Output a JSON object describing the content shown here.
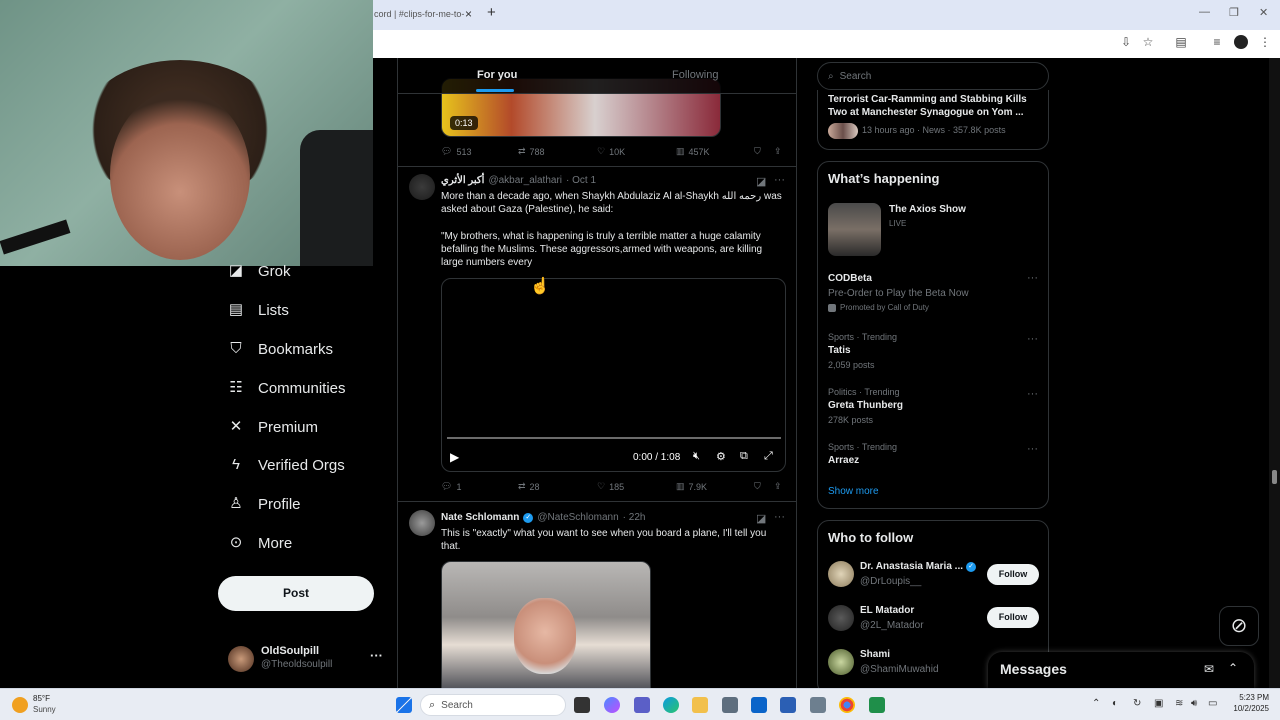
{
  "browser": {
    "tab_title": "cord | #clips-for-me-to-",
    "tab_close": "×",
    "new_tab": "+",
    "minimize": "—",
    "maximize": "❐",
    "close": "✕"
  },
  "nav": {
    "items": [
      {
        "label": "Grok",
        "icon": "grok-icon"
      },
      {
        "label": "Lists",
        "icon": "lists-icon"
      },
      {
        "label": "Bookmarks",
        "icon": "bookmark-icon"
      },
      {
        "label": "Communities",
        "icon": "communities-icon"
      },
      {
        "label": "Premium",
        "icon": "x-logo-icon"
      },
      {
        "label": "Verified Orgs",
        "icon": "lightning-icon"
      },
      {
        "label": "Profile",
        "icon": "person-icon"
      },
      {
        "label": "More",
        "icon": "more-circle-icon"
      }
    ],
    "post_label": "Post",
    "account": {
      "name": "OldSoulpill",
      "handle": "@Theoldsoulpill",
      "more": "···"
    }
  },
  "tabs": {
    "for_you": "For you",
    "following": "Following"
  },
  "tweets": [
    {
      "video_duration": "0:13",
      "replies": "513",
      "reposts": "788",
      "likes": "10K",
      "views": "457K"
    },
    {
      "name": "أكبر الأثري",
      "handle": "@akbar_alathari",
      "time": "· Oct 1",
      "text_line1": "More than a decade ago, when Shaykh Abdulaziz Al al-Shaykh رحمه الله was",
      "text_line2": "asked about Gaza (Palestine), he said:",
      "text_quote": "\"My brothers, what is happening is truly a terrible matter a huge calamity befalling the Muslims. These aggressors,armed with weapons, are killing large numbers every",
      "video_time": "0:00 / 1:08",
      "replies": "1",
      "reposts": "28",
      "likes": "185",
      "views": "7.9K"
    },
    {
      "name": "Nate Schlomann",
      "handle": "@NateSchlomann",
      "time": "· 22h",
      "text": "This is \"exactly\" what you want to see when you board a plane, I'll tell you that."
    }
  ],
  "right": {
    "search_placeholder": "Search",
    "news": {
      "title": "Terrorist Car-Ramming and Stabbing Kills Two at Manchester Synagogue on Yom ...",
      "meta": "13 hours ago · News · 357.8K posts"
    },
    "happening": {
      "heading": "What’s happening",
      "live_title": "The Axios Show",
      "live_label": "LIVE",
      "promo": {
        "name": "CODBeta",
        "desc": "Pre-Order to Play the Beta Now",
        "promoted": "Promoted by Call of Duty"
      },
      "trends": [
        {
          "cat": "Sports · Trending",
          "name": "Tatis",
          "posts": "2,059 posts"
        },
        {
          "cat": "Politics · Trending",
          "name": "Greta Thunberg",
          "posts": "278K posts"
        },
        {
          "cat": "Sports · Trending",
          "name": "Arraez",
          "posts": ""
        }
      ],
      "show_more": "Show more"
    },
    "who_to_follow": {
      "heading": "Who to follow",
      "users": [
        {
          "name": "Dr. Anastasia Maria ...",
          "handle": "@DrLoupis__",
          "button": "Follow"
        },
        {
          "name": "EL Matador",
          "handle": "@2L_Matador",
          "button": "Follow"
        },
        {
          "name": "Shami",
          "handle": "@ShamiMuwahid",
          "button": ""
        }
      ]
    },
    "messages": "Messages"
  },
  "taskbar": {
    "weather_temp": "85°F",
    "weather_desc": "Sunny",
    "search": "Search",
    "time": "5:23 PM",
    "date": "10/2/2025"
  },
  "colors": {
    "accent": "#1d9bf0",
    "bg": "#000000",
    "border": "#2f3336",
    "muted": "#71767b"
  }
}
